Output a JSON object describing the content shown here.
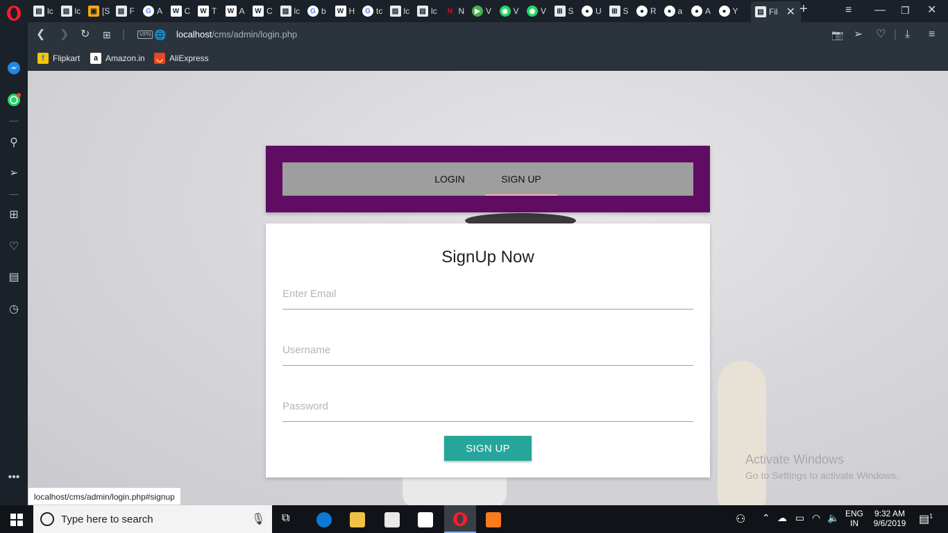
{
  "tabs": [
    {
      "icon": "doc-icon",
      "text": "lc"
    },
    {
      "icon": "doc-icon",
      "text": "lc"
    },
    {
      "icon": "image-icon",
      "text": "[S"
    },
    {
      "icon": "doc-icon",
      "text": "F"
    },
    {
      "icon": "google-icon",
      "text": "A"
    },
    {
      "icon": "wikipedia-icon",
      "text": "C"
    },
    {
      "icon": "wikipedia-icon",
      "text": "T"
    },
    {
      "icon": "wikipedia-icon",
      "text": "A"
    },
    {
      "icon": "wikipedia-icon",
      "text": "C"
    },
    {
      "icon": "doc-icon",
      "text": "lc"
    },
    {
      "icon": "google-icon",
      "text": "b"
    },
    {
      "icon": "wikipedia-icon",
      "text": "H"
    },
    {
      "icon": "google-icon",
      "text": "tc"
    },
    {
      "icon": "doc-icon",
      "text": "lc"
    },
    {
      "icon": "doc-icon",
      "text": "lc"
    },
    {
      "icon": "netflix-icon",
      "text": "N"
    },
    {
      "icon": "play-icon",
      "text": "V"
    },
    {
      "icon": "whatsapp-icon",
      "text": "V"
    },
    {
      "icon": "whatsapp-icon",
      "text": "V"
    },
    {
      "icon": "grid-icon",
      "text": "S"
    },
    {
      "icon": "github-icon",
      "text": "U"
    },
    {
      "icon": "grid-icon",
      "text": "S"
    },
    {
      "icon": "github-icon",
      "text": "R"
    },
    {
      "icon": "github-icon",
      "text": "a"
    },
    {
      "icon": "github-icon",
      "text": "A"
    },
    {
      "icon": "github-icon",
      "text": "Y"
    }
  ],
  "active_tab": {
    "icon": "doc-icon",
    "text": "Fil"
  },
  "address": {
    "host": "localhost",
    "path": "/cms/admin/login.php"
  },
  "bookmarks": [
    {
      "label": "Flipkart",
      "color": "#f7c600"
    },
    {
      "label": "Amazon.in",
      "color": "#ffffff"
    },
    {
      "label": "AliExpress",
      "color": "#e8471f"
    }
  ],
  "auth_tabs": {
    "login": "LOGIN",
    "signup": "SIGN UP"
  },
  "form": {
    "title": "SignUp Now",
    "email_placeholder": "Enter Email",
    "username_placeholder": "Username",
    "password_placeholder": "Password",
    "submit_label": "SIGN UP"
  },
  "watermark": {
    "line1": "Activate Windows",
    "line2": "Go to Settings to activate Windows."
  },
  "status_url": "localhost/cms/admin/login.php#signup",
  "taskbar": {
    "search_placeholder": "Type here to search",
    "lang_top": "ENG",
    "lang_bottom": "IN",
    "time": "9:32 AM",
    "date": "9/6/2019",
    "notification_count": "1"
  },
  "colors": {
    "header_purple": "#610c63",
    "tab_gray": "#9e9e9e",
    "button_teal": "#26a69a",
    "underline_pink": "#f6b2b5"
  }
}
